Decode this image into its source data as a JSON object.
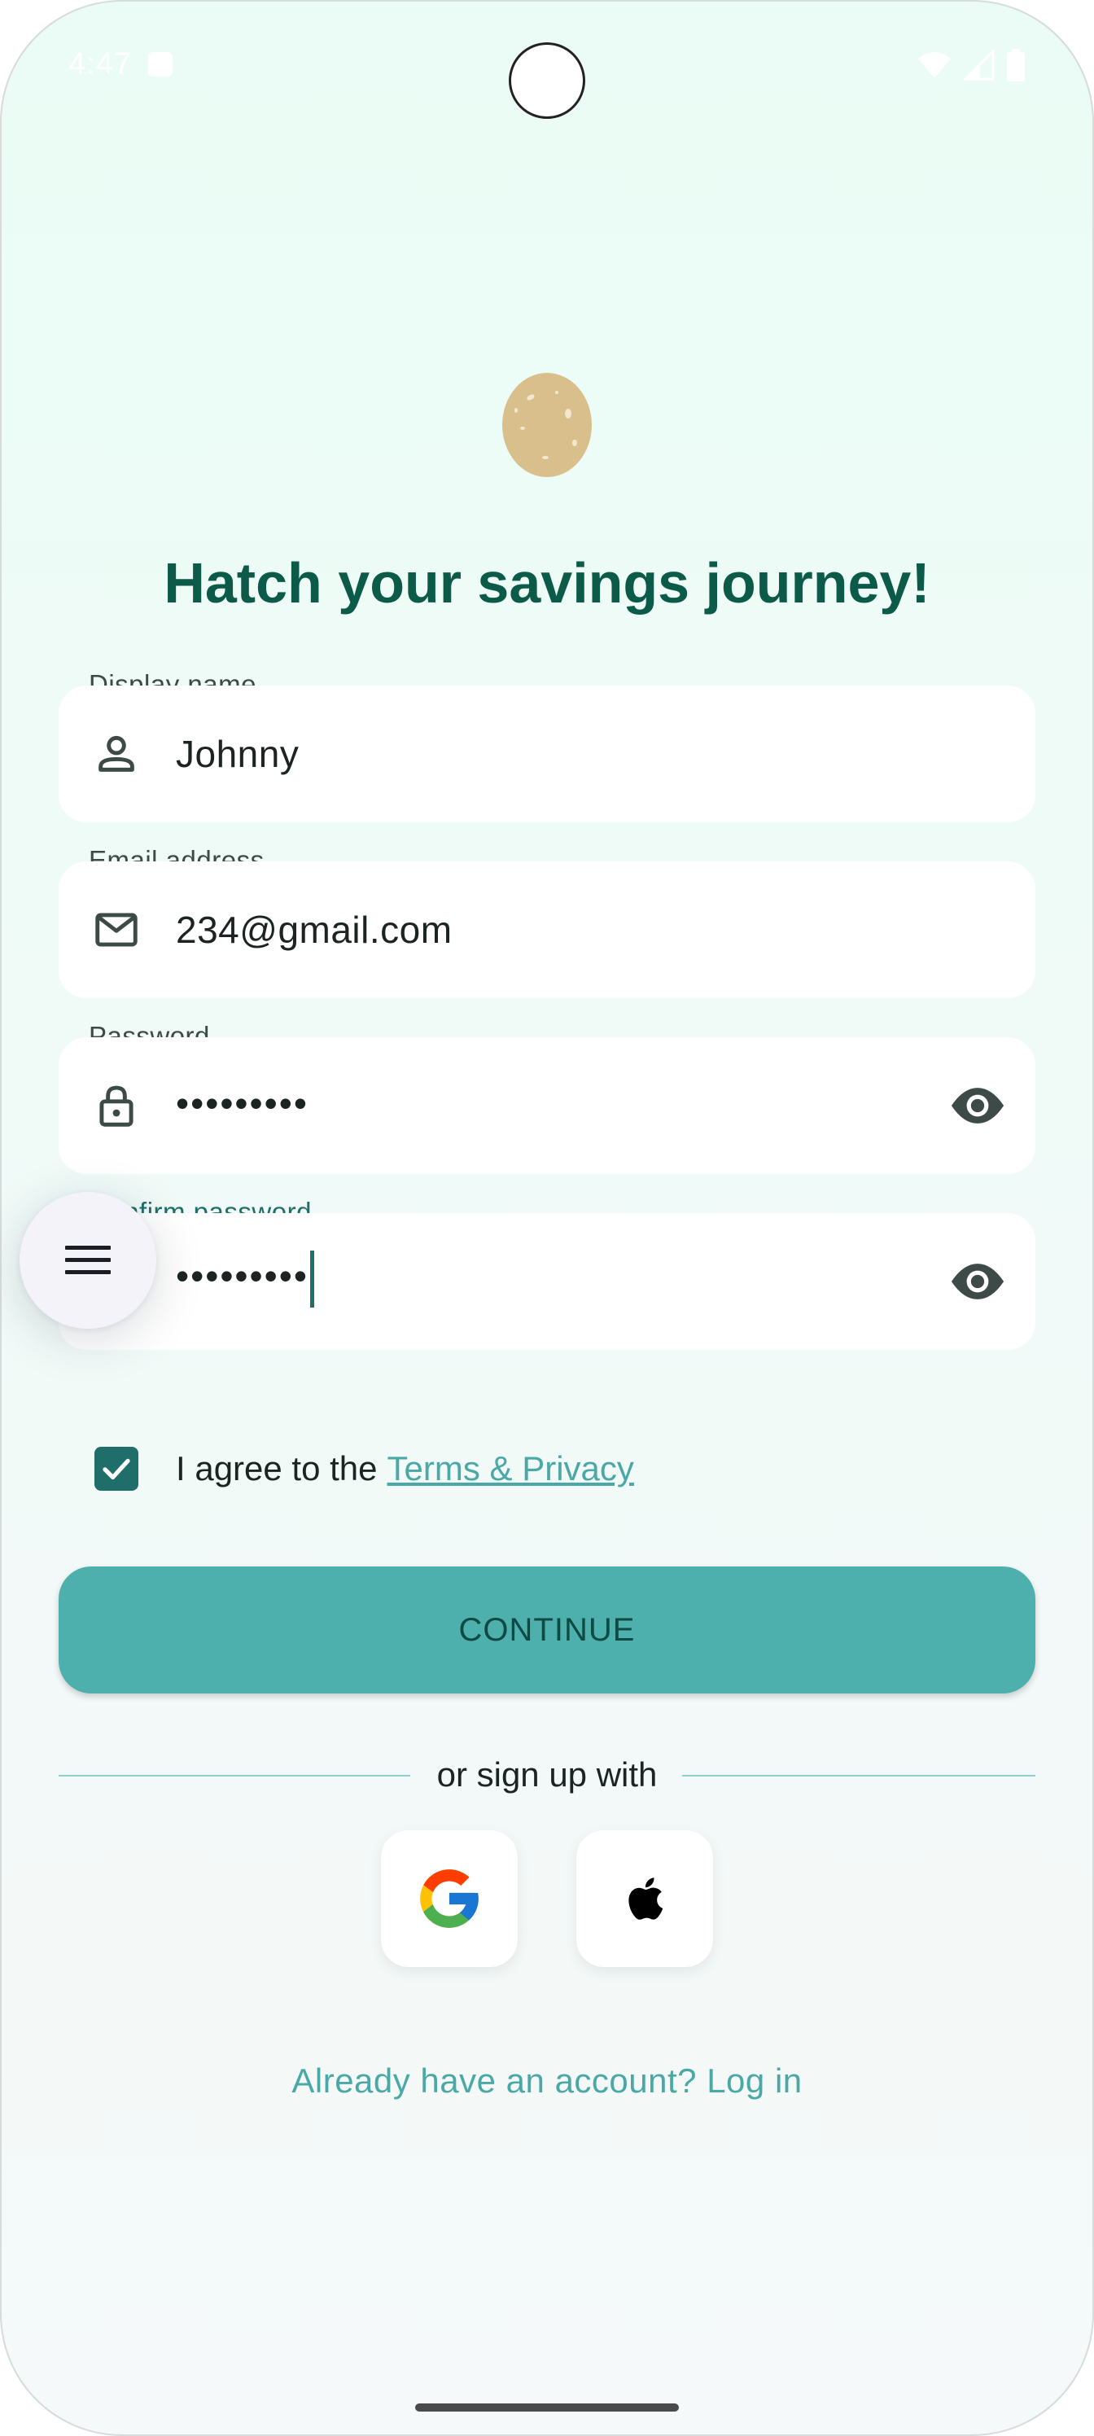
{
  "status_bar": {
    "time": "4:47",
    "icons": [
      "notification-icon",
      "wifi-icon",
      "signal-icon",
      "battery-icon"
    ]
  },
  "header": {
    "logo": "egg-logo",
    "title": "Hatch your savings journey!"
  },
  "form": {
    "display_name": {
      "label": "Display name",
      "value": "Johnny",
      "icon": "person-icon"
    },
    "email": {
      "label": "Email address",
      "value": "234@gmail.com",
      "icon": "mail-icon"
    },
    "password": {
      "label": "Password",
      "value": "•••••••••",
      "icon": "lock-icon",
      "toggle_icon": "eye-icon"
    },
    "confirm_password": {
      "label": "Confirm password",
      "value": "•••••••••",
      "toggle_icon": "eye-icon",
      "focused": true
    },
    "agree": {
      "checked": true,
      "text": "I agree to the",
      "link": "Terms & Privacy"
    },
    "continue_label": "CONTINUE"
  },
  "social": {
    "divider_text": "or sign up with",
    "buttons": [
      "google-icon",
      "apple-icon"
    ]
  },
  "footer": {
    "login_link": "Already have an account? Log in"
  },
  "floating_menu": {
    "icon": "menu-icon"
  },
  "colors": {
    "primary": "#1f6e6a",
    "accent": "#4eb0ad",
    "title": "#0c5a48",
    "link": "#4aa8a7",
    "egg": "#d8bf8c"
  }
}
